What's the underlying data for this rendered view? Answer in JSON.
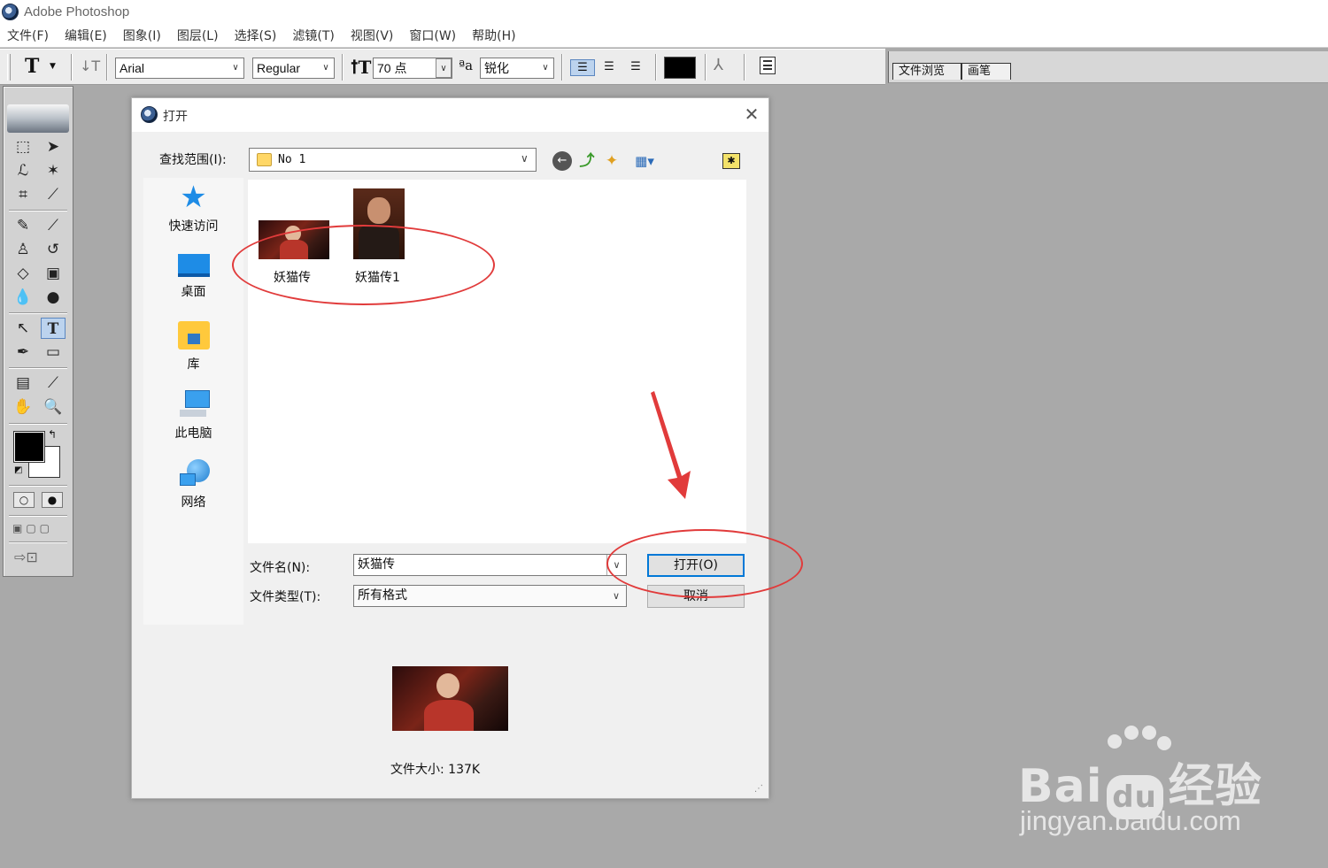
{
  "app": {
    "title": "Adobe Photoshop"
  },
  "menu": [
    "文件(F)",
    "编辑(E)",
    "图象(I)",
    "图层(L)",
    "选择(S)",
    "滤镜(T)",
    "视图(V)",
    "窗口(W)",
    "帮助(H)"
  ],
  "options": {
    "tool_glyph": "T",
    "font_family": "Arial",
    "font_style": "Regular",
    "font_size": "70 点",
    "antialias_prefix": "ªa",
    "antialias": "锐化",
    "text_color": "#000000"
  },
  "palette_tabs": [
    "文件浏览",
    "画笔"
  ],
  "dialog": {
    "title": "打开",
    "look_in_label": "查找范围(I):",
    "look_in_value": "No 1",
    "places": [
      "快速访问",
      "桌面",
      "库",
      "此电脑",
      "网络"
    ],
    "files": [
      "妖猫传",
      "妖猫传1"
    ],
    "filename_label": "文件名(N):",
    "filename_value": "妖猫传",
    "filetype_label": "文件类型(T):",
    "filetype_value": "所有格式",
    "open_button": "打开(O)",
    "cancel_button": "取消",
    "file_size": "文件大小: 137K"
  },
  "annotation_color": "#e13b3b",
  "watermark": {
    "brand": "Bai",
    "brand_cn": "经验",
    "url": "jingyan.baidu.com"
  }
}
